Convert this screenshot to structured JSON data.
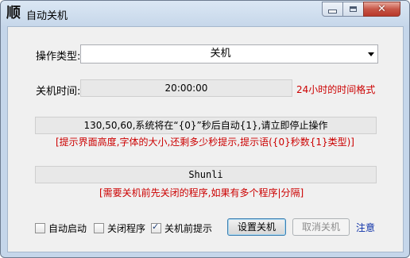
{
  "window": {
    "title": "自动关机",
    "app_icon": "顺"
  },
  "form": {
    "op_type_label": "操作类型:",
    "op_type_value": "关机",
    "time_label": "关机时间:",
    "time_value": "20:00:00",
    "time_hint": "24小时的时间格式",
    "prompt_value": "130,50,60,系统将在“{0}”秒后自动{1},请立即停止操作",
    "prompt_hint": "[提示界面高度,字体的大小,还剩多少秒提示,提示语({0}秒数{1}类型)]",
    "programs_value": "Shunli",
    "programs_hint": "[需要关机前先关闭的程序,如果有多个程序|分隔]"
  },
  "options": {
    "autostart_label": "自动启动",
    "autostart_checked": false,
    "close_programs_label": "关闭程序",
    "close_programs_checked": false,
    "notify_label": "关机前提示",
    "notify_checked": true
  },
  "buttons": {
    "set_label": "设置关机",
    "cancel_label": "取消关机",
    "note_label": "注意"
  },
  "colors": {
    "hint_red": "#cc0000",
    "link_blue": "#0b2fa8",
    "frame": "#c5d6ea"
  },
  "icons": [
    "minimize-icon",
    "maximize-icon",
    "close-icon",
    "dropdown-arrow-icon",
    "checkmark-icon"
  ]
}
